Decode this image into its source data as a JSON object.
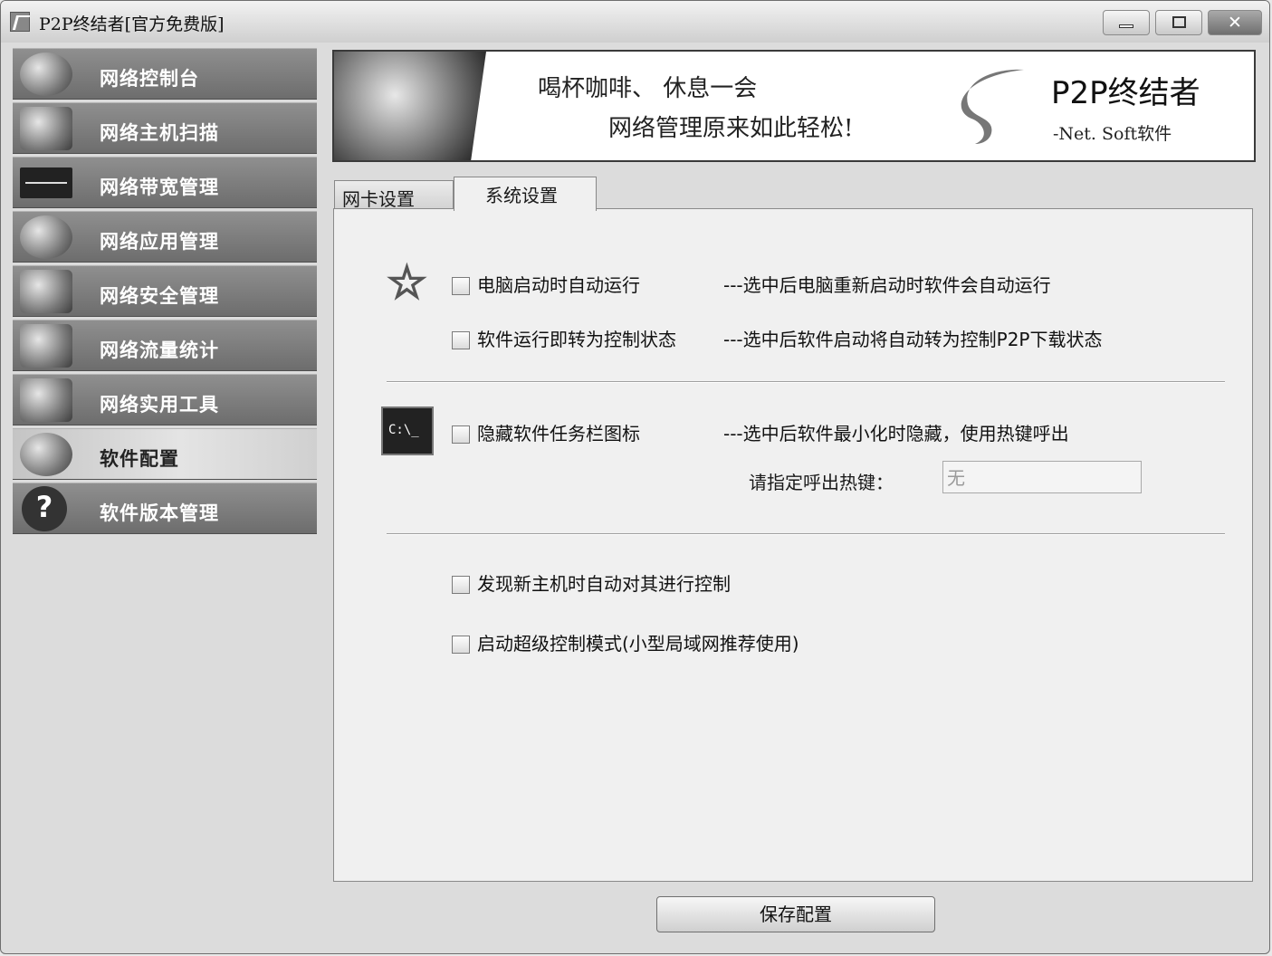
{
  "window": {
    "title": "P2P终结者[官方免费版]"
  },
  "sidebar": {
    "items": [
      {
        "label": "网络控制台",
        "icon": "globe-icon"
      },
      {
        "label": "网络主机扫描",
        "icon": "computer-icon"
      },
      {
        "label": "网络带宽管理",
        "icon": "waveform-icon"
      },
      {
        "label": "网络应用管理",
        "icon": "apps-icon"
      },
      {
        "label": "网络安全管理",
        "icon": "keys-icon"
      },
      {
        "label": "网络流量统计",
        "icon": "chart-icon"
      },
      {
        "label": "网络实用工具",
        "icon": "tools-icon"
      },
      {
        "label": "软件配置",
        "icon": "gear-globe-icon",
        "active": true
      },
      {
        "label": "软件版本管理",
        "icon": "question-icon"
      }
    ]
  },
  "banner": {
    "slogan_line1": "喝杯咖啡、  休息一会",
    "slogan_line2": "网络管理原来如此轻松!",
    "brand_name": "P2P终结者",
    "brand_sub": "-Net. Soft软件"
  },
  "tabs": [
    {
      "label": "网卡设置",
      "active": false
    },
    {
      "label": "系统设置",
      "active": true
    }
  ],
  "settings": {
    "opt_autostart": {
      "label": "电脑启动时自动运行",
      "checked": false,
      "desc": "---选中后电脑重新启动时软件会自动运行"
    },
    "opt_control": {
      "label": "软件运行即转为控制状态",
      "checked": false,
      "desc": "---选中后软件启动将自动转为控制P2P下载状态"
    },
    "opt_hide_tray": {
      "label": "隐藏软件任务栏图标",
      "checked": false,
      "desc": "---选中后软件最小化时隐藏，使用热键呼出"
    },
    "hotkey": {
      "label": "请指定呼出热键：",
      "value": "无"
    },
    "opt_auto_new_host": {
      "label": "发现新主机时自动对其进行控制",
      "checked": false
    },
    "opt_super_mode": {
      "label": "启动超级控制模式(小型局域网推荐使用)",
      "checked": false
    }
  },
  "save_button": "保存配置"
}
